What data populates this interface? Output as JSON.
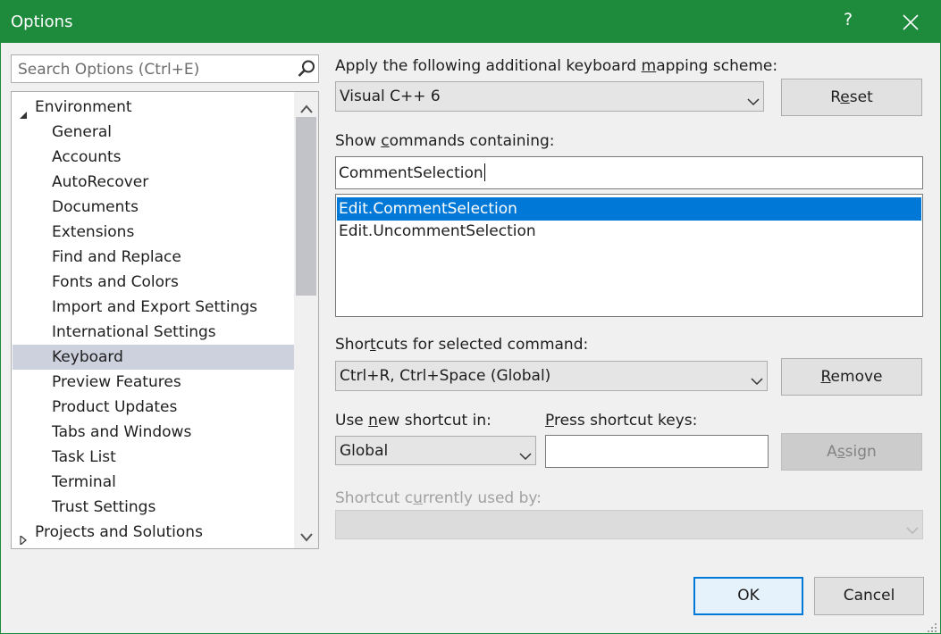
{
  "window": {
    "title": "Options",
    "help_label": "?",
    "close_icon": "close-icon",
    "accent_color": "#1e8a3c"
  },
  "search": {
    "placeholder": "Search Options (Ctrl+E)",
    "icon": "search-icon"
  },
  "tree": {
    "items": [
      {
        "label": "Environment",
        "level": 0,
        "expanded": true
      },
      {
        "label": "General",
        "level": 1
      },
      {
        "label": "Accounts",
        "level": 1
      },
      {
        "label": "AutoRecover",
        "level": 1
      },
      {
        "label": "Documents",
        "level": 1
      },
      {
        "label": "Extensions",
        "level": 1
      },
      {
        "label": "Find and Replace",
        "level": 1
      },
      {
        "label": "Fonts and Colors",
        "level": 1
      },
      {
        "label": "Import and Export Settings",
        "level": 1
      },
      {
        "label": "International Settings",
        "level": 1
      },
      {
        "label": "Keyboard",
        "level": 1,
        "selected": true
      },
      {
        "label": "Preview Features",
        "level": 1
      },
      {
        "label": "Product Updates",
        "level": 1
      },
      {
        "label": "Tabs and Windows",
        "level": 1
      },
      {
        "label": "Task List",
        "level": 1
      },
      {
        "label": "Terminal",
        "level": 1
      },
      {
        "label": "Trust Settings",
        "level": 1
      },
      {
        "label": "Projects and Solutions",
        "level": 0,
        "expanded": false
      }
    ],
    "selected_color": "#cdd0dd"
  },
  "keyboard": {
    "mapping_label": {
      "pre": "Apply the following additional keyboard ",
      "u": "m",
      "post": "apping scheme:"
    },
    "mapping_value": "Visual C++ 6",
    "reset_button": {
      "pre": "R",
      "u": "e",
      "post": "set"
    },
    "show_commands_label": {
      "pre": "Show ",
      "u": "c",
      "post": "ommands containing:"
    },
    "show_commands_value": "CommentSelection",
    "commands": [
      {
        "label": "Edit.CommentSelection",
        "selected": true
      },
      {
        "label": "Edit.UncommentSelection",
        "selected": false
      }
    ],
    "shortcuts_label": {
      "pre": "Shor",
      "u": "t",
      "post": "cuts for selected command:"
    },
    "shortcuts_value": "Ctrl+R, Ctrl+Space (Global)",
    "remove_button": {
      "pre": "",
      "u": "R",
      "post": "emove"
    },
    "use_new_label": {
      "pre": "Use ",
      "u": "n",
      "post": "ew shortcut in:"
    },
    "use_new_value": "Global",
    "press_keys_label": {
      "pre": "",
      "u": "P",
      "post": "ress shortcut keys:"
    },
    "press_keys_value": "",
    "assign_button": {
      "pre": "A",
      "u": "s",
      "post": "sign"
    },
    "used_by_label": {
      "pre": "Shortcut c",
      "u": "u",
      "post": "rrently used by:"
    },
    "used_by_value": "",
    "selection_color": "#0078d7"
  },
  "footer": {
    "ok_label": "OK",
    "cancel_label": "Cancel"
  }
}
